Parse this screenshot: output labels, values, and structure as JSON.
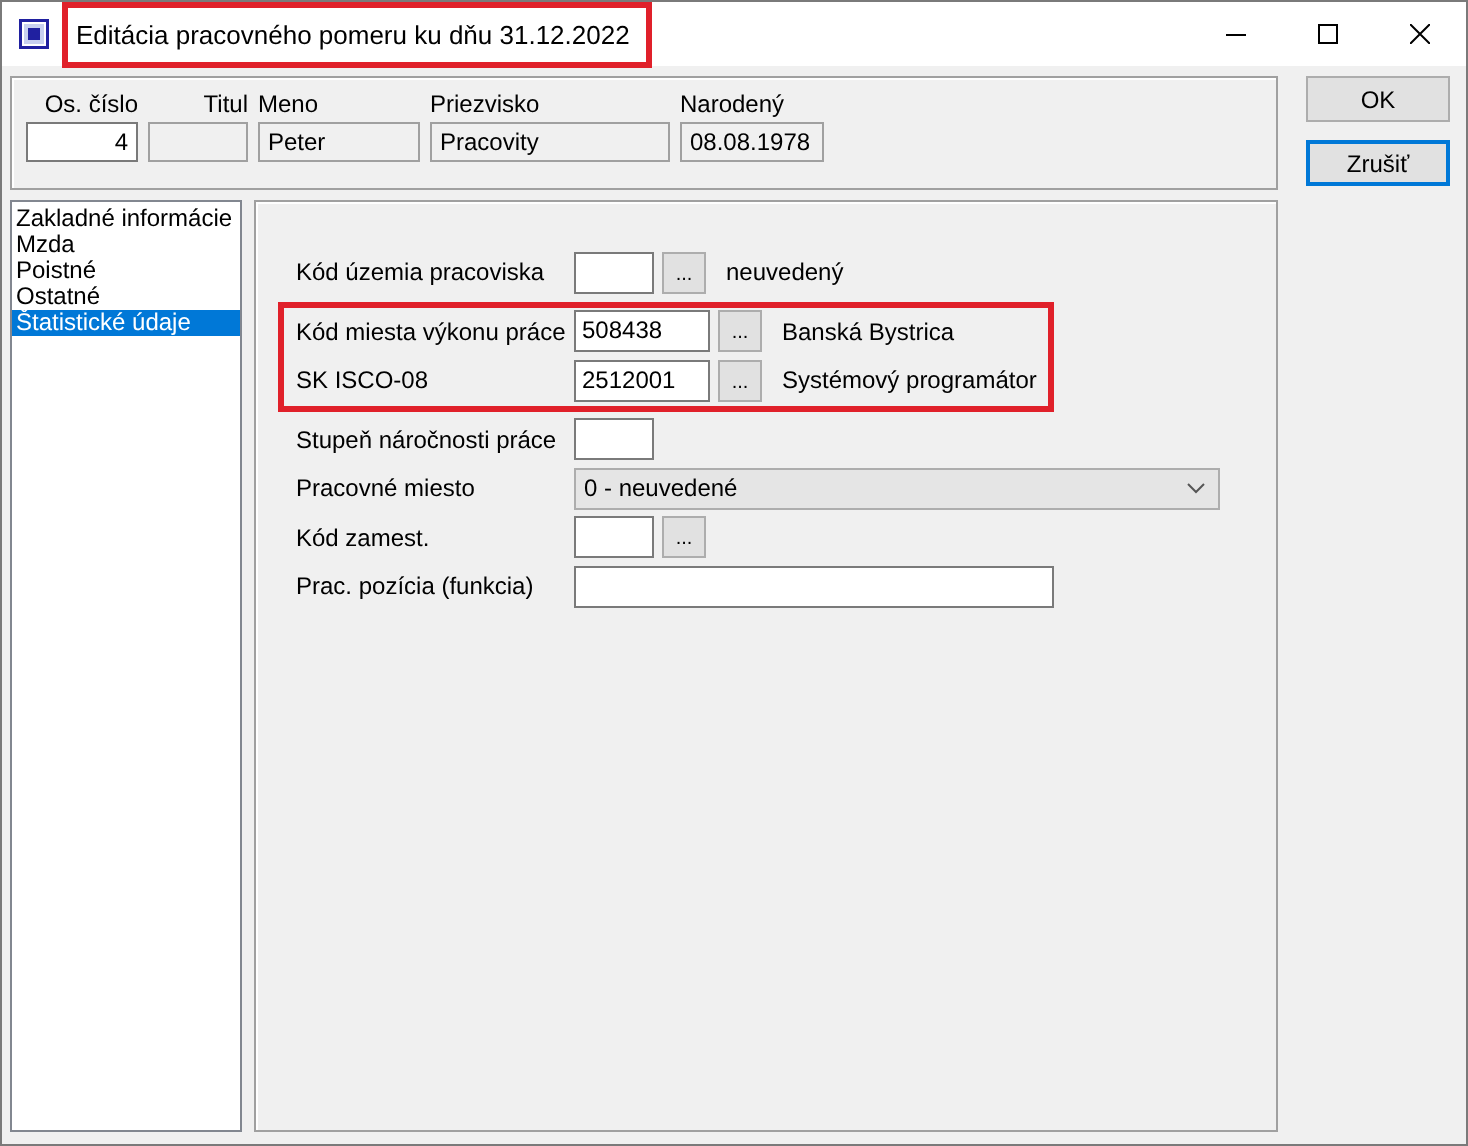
{
  "window": {
    "title": "Editácia pracovného pomeru ku dňu  31.12.2022",
    "title_highlighted": true
  },
  "header": [
    {
      "label": "Os. číslo",
      "value": "4",
      "editable": true
    },
    {
      "label": "Titul",
      "editable": false
    },
    {
      "label": "Meno",
      "value": "Peter",
      "editable": false
    },
    {
      "label": "Priezvisko",
      "value": "Pracovity",
      "editable": false
    },
    {
      "label": "Narodený",
      "value": "08.08.1978",
      "editable": false
    }
  ],
  "buttons": [
    {
      "label": "OK",
      "default": false
    },
    {
      "label": "Zrušiť",
      "default": true
    }
  ],
  "sidebar": {
    "items": [
      {
        "label": "Zakladné informácie",
        "selected": false
      },
      {
        "label": "Mzda",
        "selected": false
      },
      {
        "label": "Poistné",
        "selected": false
      },
      {
        "label": "Ostatné",
        "selected": false
      },
      {
        "label": "Štatistické údaje",
        "selected": true
      }
    ]
  },
  "sections": [
    {
      "highlighted": false,
      "rows": [
        {
          "kind": "code",
          "label": "Kód územia pracoviska",
          "button": "...",
          "description": "neuvedený"
        }
      ]
    },
    {
      "highlighted": true,
      "rows": [
        {
          "kind": "code",
          "label": "Kód miesta výkonu práce",
          "value": "508438",
          "button": "...",
          "description": "Banská Bystrica"
        },
        {
          "kind": "code",
          "label": "SK ISCO-08",
          "value": "2512001",
          "button": "...",
          "description": "Systémový programátor"
        }
      ]
    },
    {
      "highlighted": false,
      "rows": [
        {
          "kind": "code",
          "label": "Stupeň náročnosti práce"
        },
        {
          "kind": "select",
          "label": "Pracovné miesto",
          "value": "0 - neuvedené"
        },
        {
          "kind": "code",
          "label": "Kód zamest.",
          "button": "..."
        },
        {
          "kind": "text",
          "label": "Prac. pozícia (funkcia)"
        }
      ]
    }
  ]
}
